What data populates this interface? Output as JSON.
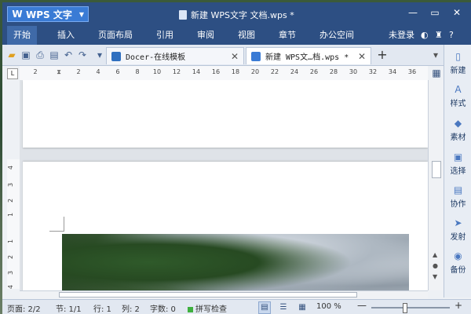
{
  "app": {
    "name": "WPS 文字",
    "logo_glyph": "W"
  },
  "window": {
    "title": "新建 WPS文字 文档.wps *"
  },
  "menu": {
    "items": [
      "开始",
      "插入",
      "页面布局",
      "引用",
      "审阅",
      "视图",
      "章节",
      "办公空间"
    ],
    "active_index": 0,
    "login": "未登录"
  },
  "tabs": [
    {
      "label": "Docer-在线模板",
      "active": false,
      "icon_color": "#2f6fbf"
    },
    {
      "label": "新建 WPS文…档.wps *",
      "active": true,
      "icon_color": "#3a7bd5"
    }
  ],
  "ruler": {
    "marks": [
      "2",
      "2",
      "2",
      "4",
      "6",
      "8",
      "10",
      "12",
      "14",
      "16",
      "18",
      "20",
      "22",
      "24",
      "26",
      "28",
      "30",
      "32",
      "34",
      "36"
    ]
  },
  "vruler": {
    "marks": [
      "4",
      "3",
      "2",
      "1",
      "1",
      "2",
      "3",
      "4"
    ]
  },
  "right_panel": {
    "items": [
      {
        "label": "新建",
        "icon": "new-doc-icon",
        "glyph": "▯"
      },
      {
        "label": "样式",
        "icon": "style-icon",
        "glyph": "A"
      },
      {
        "label": "素材",
        "icon": "material-icon",
        "glyph": "◆"
      },
      {
        "label": "选择",
        "icon": "select-icon",
        "glyph": "▣"
      },
      {
        "label": "协作",
        "icon": "collab-icon",
        "glyph": "▤"
      },
      {
        "label": "发射",
        "icon": "send-icon",
        "glyph": "➤"
      },
      {
        "label": "备份",
        "icon": "backup-icon",
        "glyph": "◉"
      }
    ]
  },
  "status": {
    "page": "页面: 2/2",
    "section": "节: 1/1",
    "row": "行: 1",
    "col": "列: 2",
    "words": "字数: 0",
    "spell": "拼写检查",
    "zoom": "100 %"
  },
  "colors": {
    "titlebar": "#2d4f83",
    "accent": "#3a7bd5"
  }
}
